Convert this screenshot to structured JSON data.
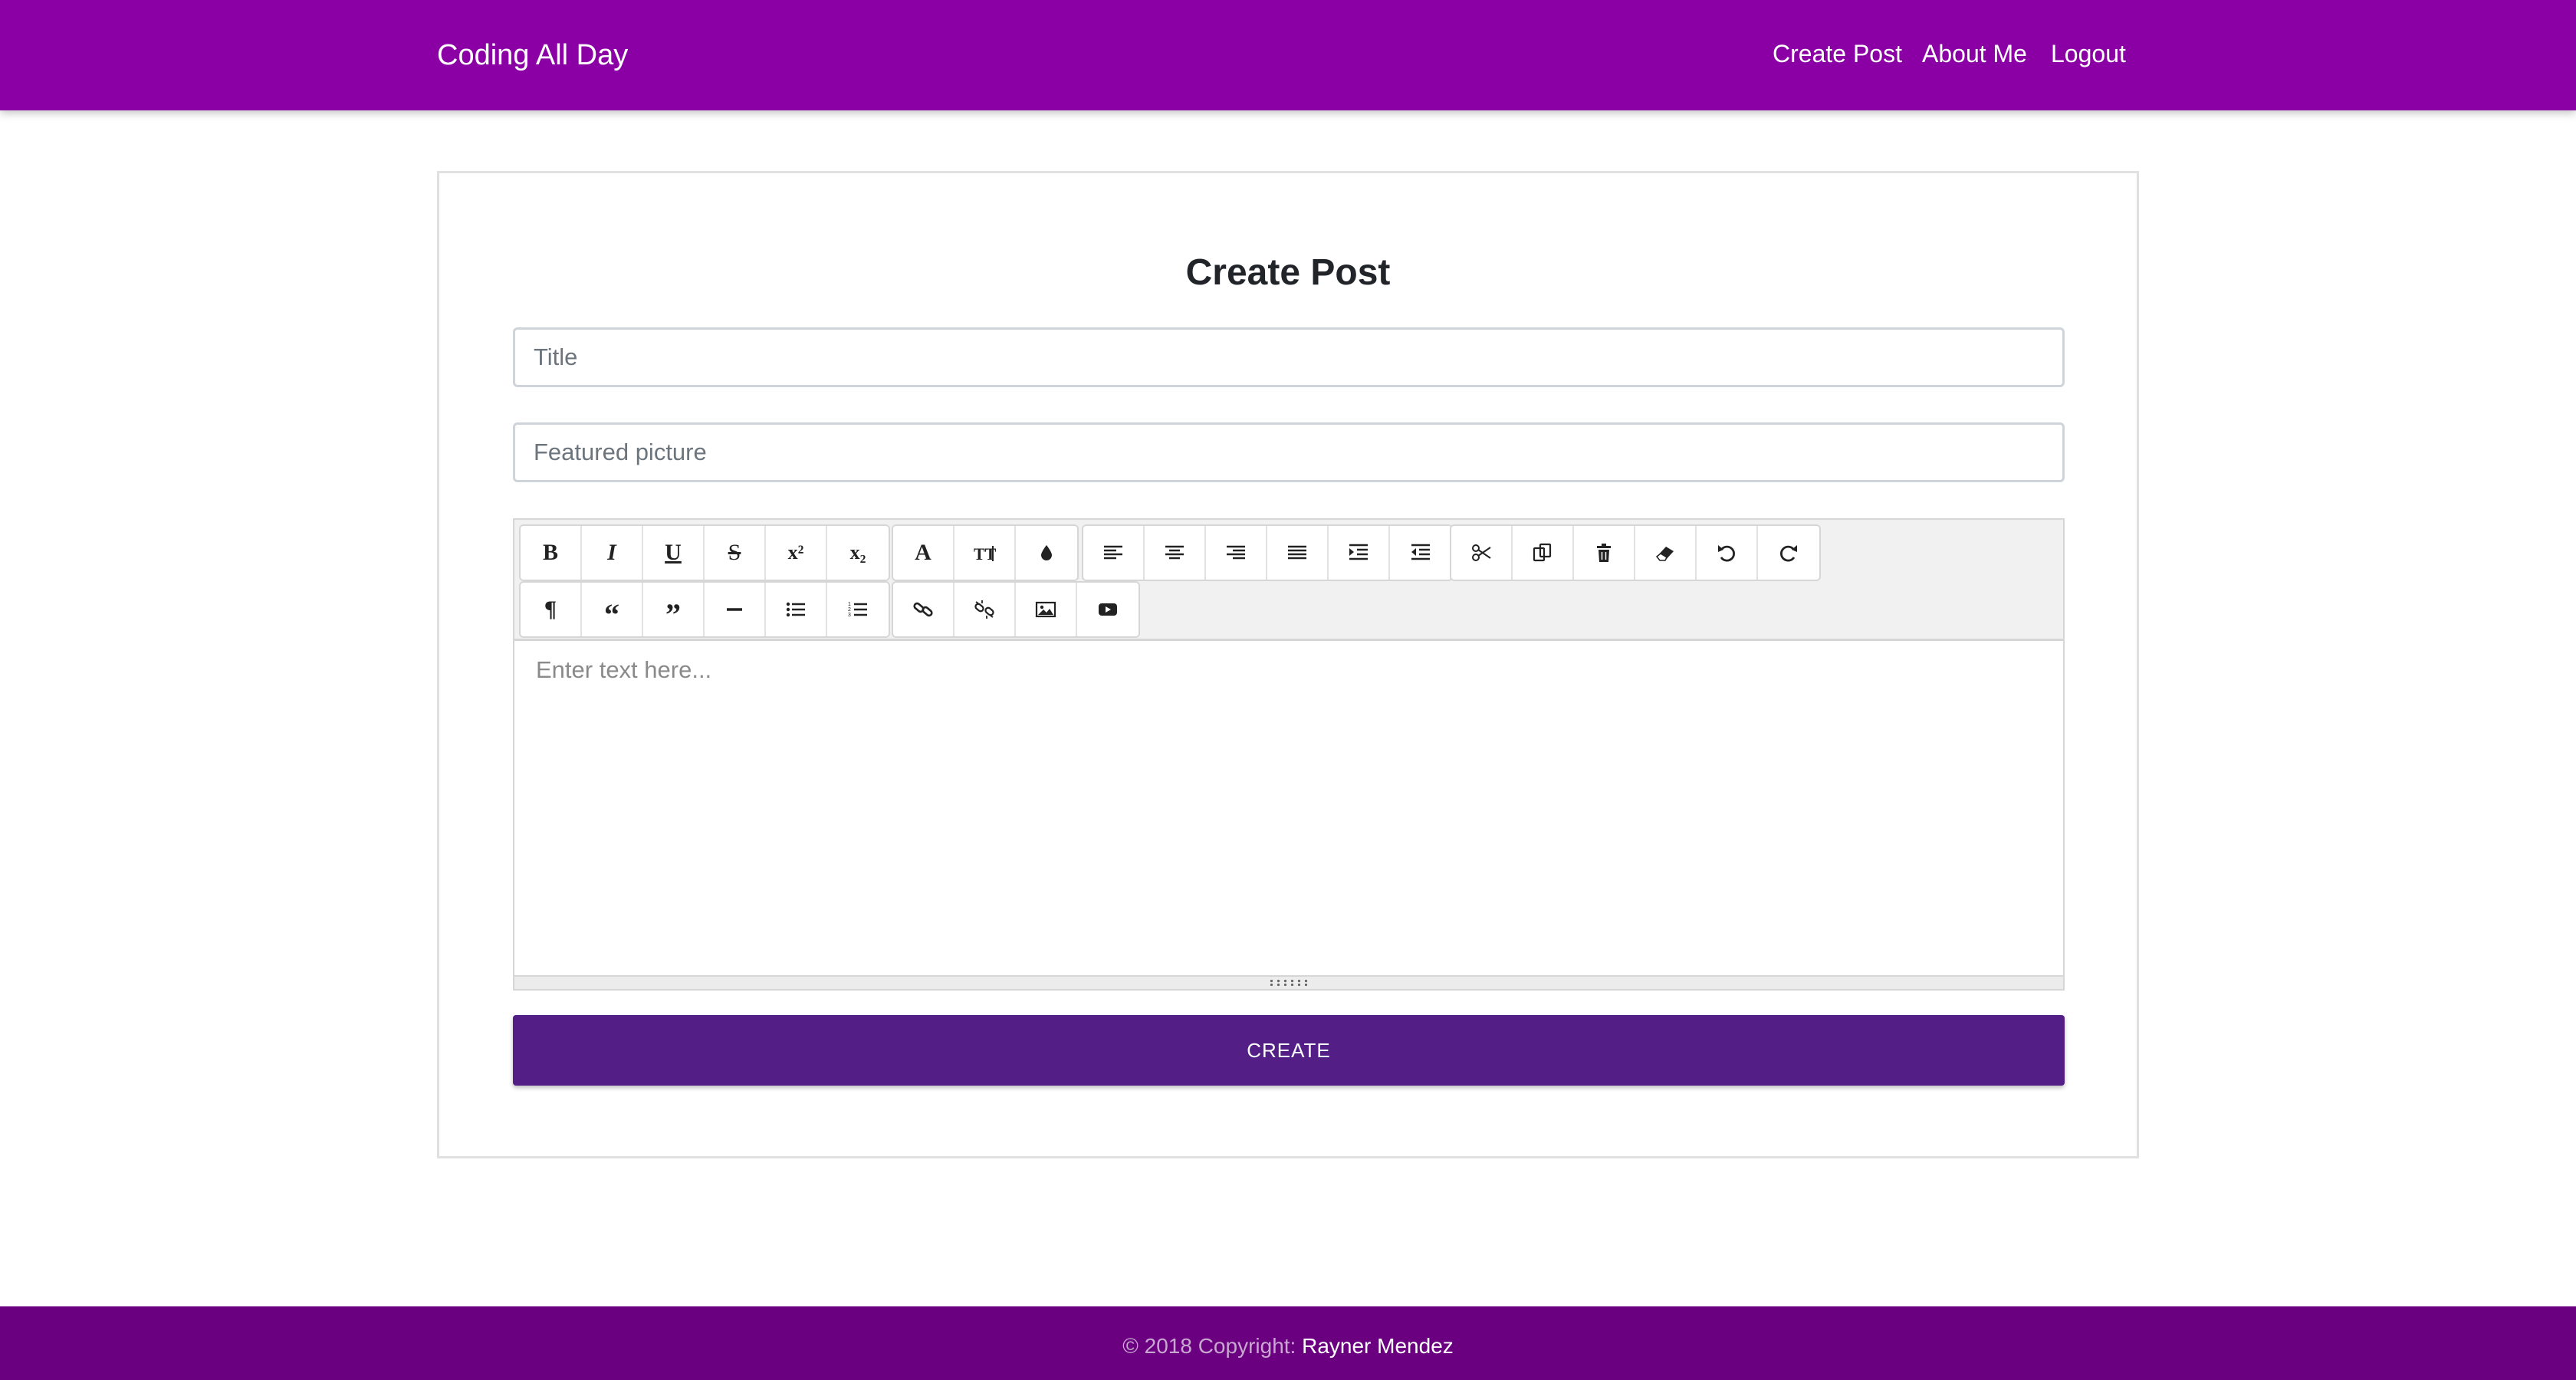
{
  "navbar": {
    "brand": "Coding All Day",
    "links": [
      "Create Post",
      "About Me",
      "Logout"
    ],
    "color": "#8b00a5"
  },
  "card": {
    "title": "Create Post",
    "title_placeholder": "Title",
    "picture_placeholder": "Featured picture"
  },
  "editor": {
    "placeholder": "Enter text here...",
    "toolbar_row1": {
      "group1": [
        "bold-icon",
        "italic-icon",
        "underline-icon",
        "strikethrough-icon",
        "superscript-icon",
        "subscript-icon"
      ],
      "group2": [
        "font-icon",
        "font-size-icon",
        "text-color-icon"
      ],
      "group3": [
        "align-left-icon",
        "align-center-icon",
        "align-right-icon",
        "align-justify-icon",
        "indent-icon",
        "outdent-icon"
      ],
      "group4": [
        "cut-icon",
        "copy-icon",
        "delete-icon",
        "eraser-icon",
        "undo-icon",
        "redo-icon"
      ]
    },
    "toolbar_row2": {
      "group1": [
        "paragraph-icon",
        "quote-left-icon",
        "quote-right-icon",
        "horizontal-rule-icon",
        "bullet-list-icon",
        "numbered-list-icon"
      ],
      "group2": [
        "link-icon",
        "unlink-icon",
        "image-icon",
        "video-icon"
      ]
    }
  },
  "create_button": {
    "label": "CREATE",
    "color": "#531f87"
  },
  "footer": {
    "prefix": "© 2018 Copyright: ",
    "author": "Rayner Mendez",
    "color": "#6a0080"
  }
}
